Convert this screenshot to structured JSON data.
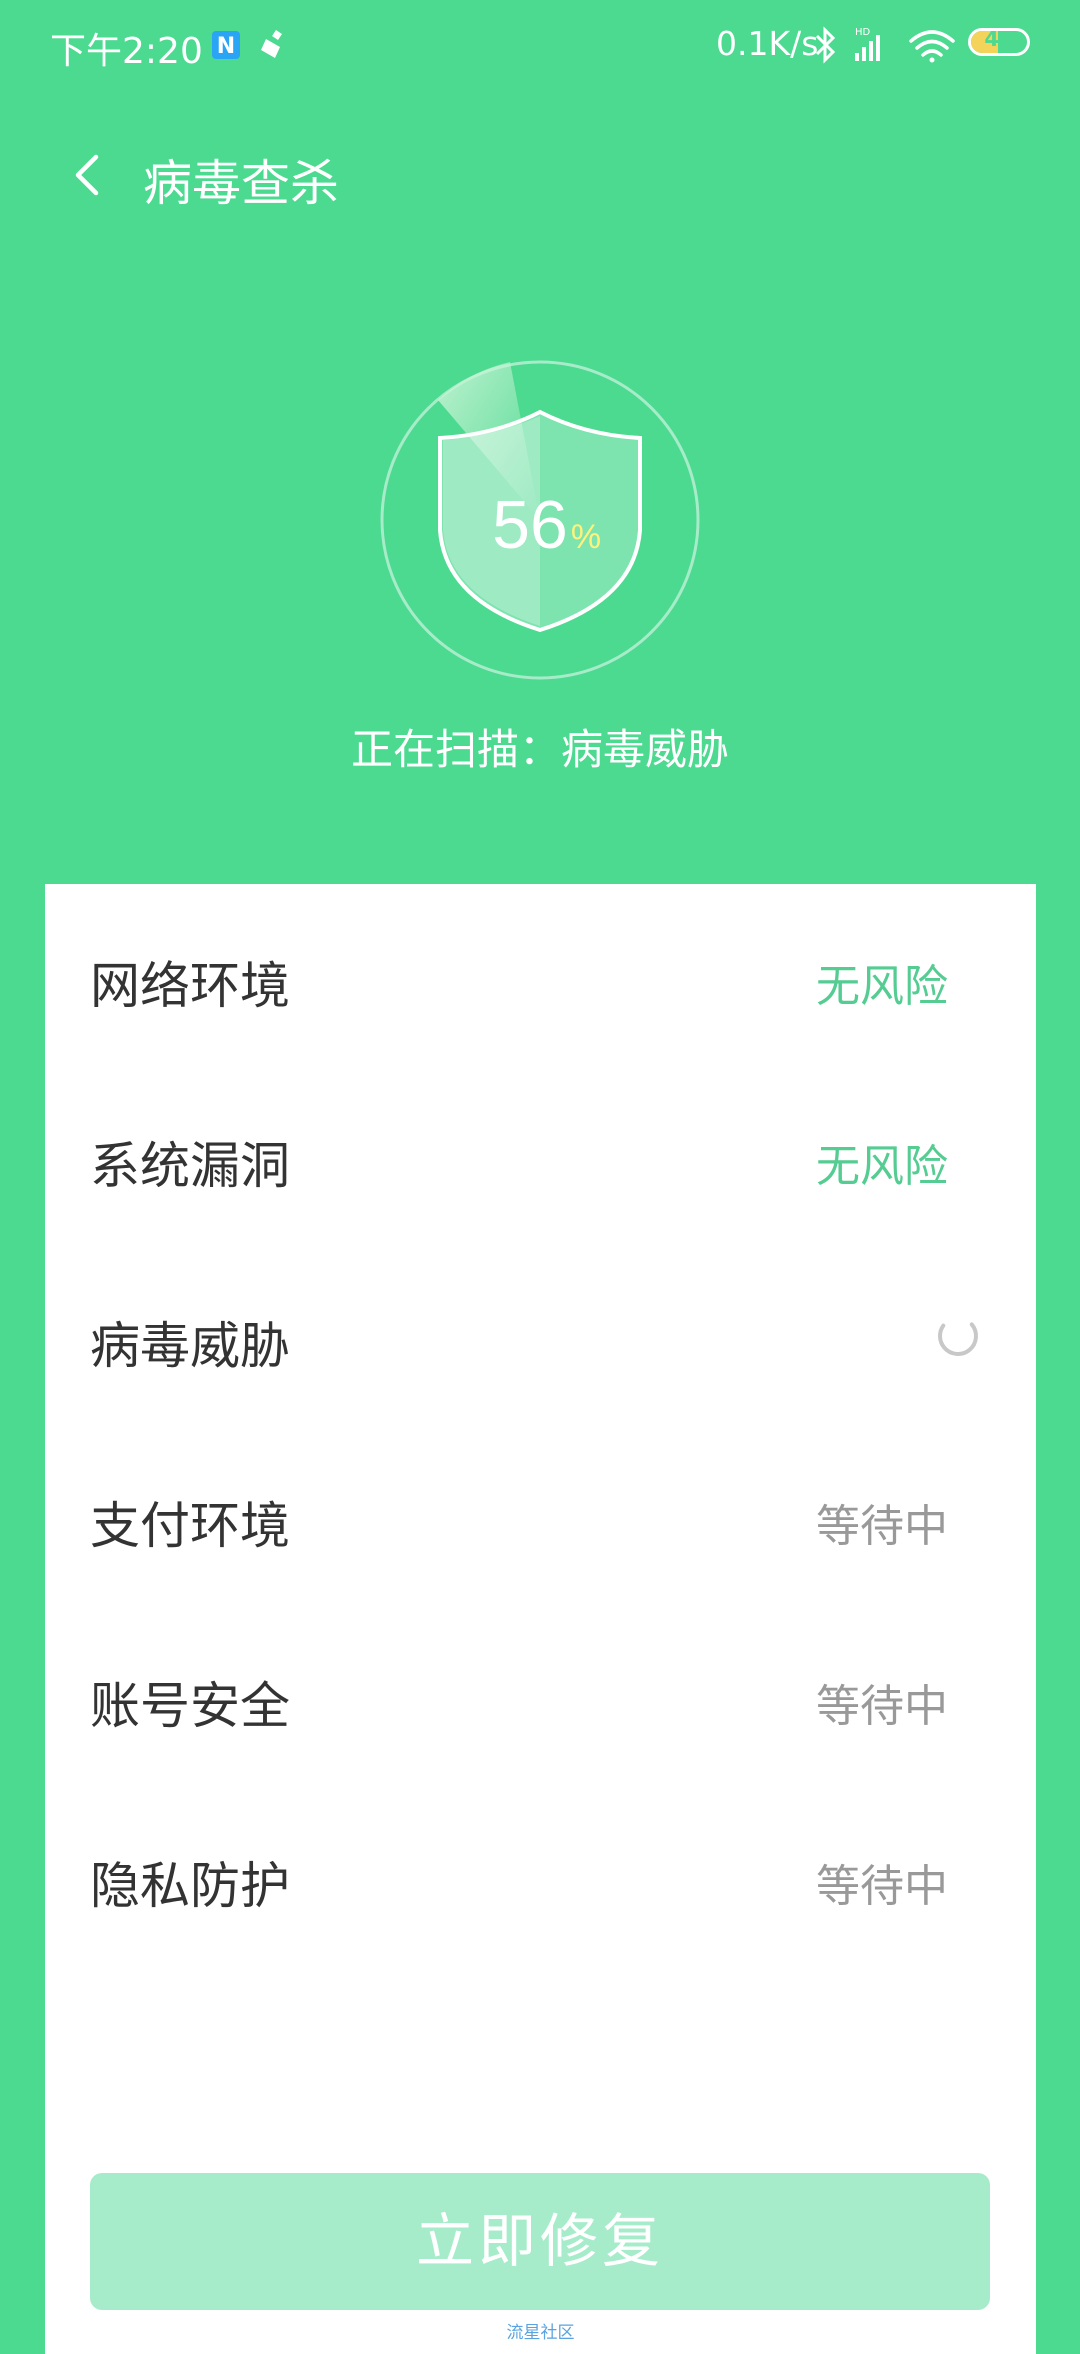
{
  "status_bar": {
    "time": "下午2:20",
    "net_speed": "0.1K/s",
    "battery": "48",
    "battery_level": 0.48,
    "icons": [
      "notification-n-icon",
      "broom-icon",
      "bluetooth-icon",
      "hd-signal-icon",
      "wifi-icon",
      "battery-icon"
    ]
  },
  "header": {
    "title": "病毒查杀",
    "back_icon": "chevron-left-icon"
  },
  "scan": {
    "percent_value": "56",
    "percent_sign": "%",
    "progress": 0.56,
    "status_text": "正在扫描：病毒威胁"
  },
  "items": [
    {
      "label": "网络环境",
      "status": "无风险",
      "state": "safe"
    },
    {
      "label": "系统漏洞",
      "status": "无风险",
      "state": "safe"
    },
    {
      "label": "病毒威胁",
      "status": "",
      "state": "scanning"
    },
    {
      "label": "支付环境",
      "status": "等待中",
      "state": "waiting"
    },
    {
      "label": "账号安全",
      "status": "等待中",
      "state": "waiting"
    },
    {
      "label": "隐私防护",
      "status": "等待中",
      "state": "waiting"
    }
  ],
  "fix_button": {
    "label": "立即修复"
  },
  "watermark": "流星社区",
  "colors": {
    "background": "#4cd990",
    "safe_text": "#55cc92",
    "button": "#a6ecca",
    "percent_sign": "#fff27a"
  }
}
